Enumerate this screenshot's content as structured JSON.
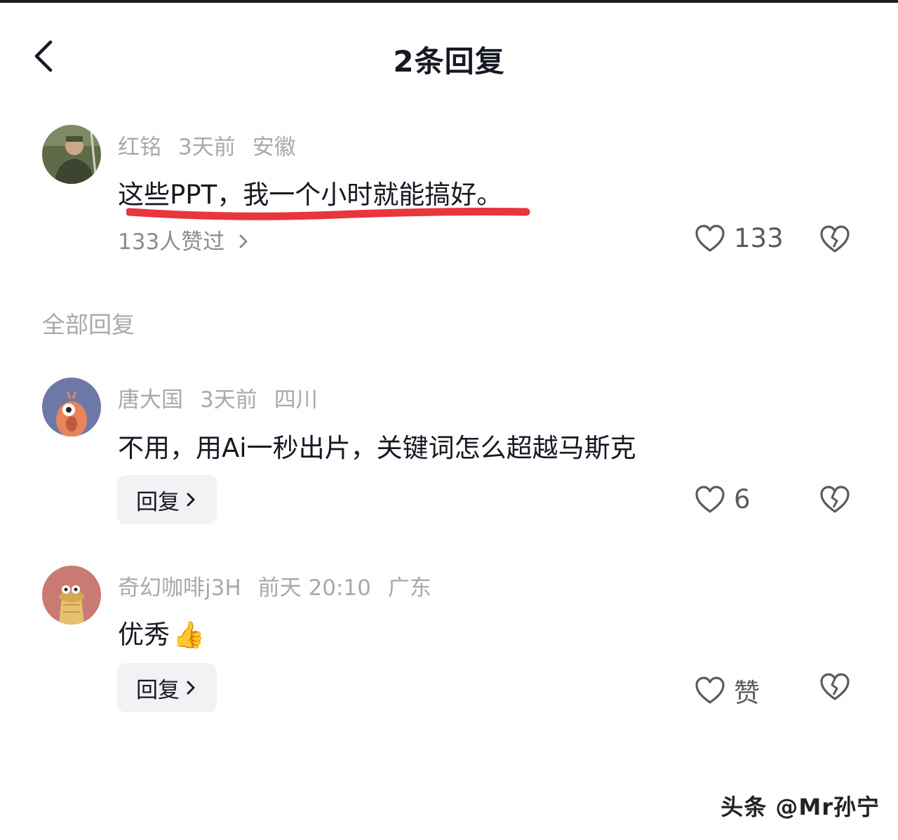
{
  "header": {
    "title": "2条回复"
  },
  "parent_comment": {
    "author": "红铭",
    "time": "3天前",
    "location": "安徽",
    "text": "这些PPT，我一个小时就能搞好。",
    "likers_summary": "133人赞过",
    "like_count": "133"
  },
  "section": {
    "label": "全部回复"
  },
  "replies": [
    {
      "author": "唐大国",
      "time": "3天前",
      "location": "四川",
      "text": "不用，用Ai一秒出片，关键词怎么超越马斯克",
      "reply_label": "回复",
      "like_count": "6"
    },
    {
      "author": "奇幻咖啡j3H",
      "time": "前天 20:10",
      "location": "广东",
      "text": "优秀",
      "emoji": "👍",
      "reply_label": "回复",
      "like_count": "赞"
    }
  ],
  "watermark": "头条 @Mr孙宁",
  "colors": {
    "annotation_underline": "#e8363c",
    "meta_gray": "#a8a9ad"
  }
}
